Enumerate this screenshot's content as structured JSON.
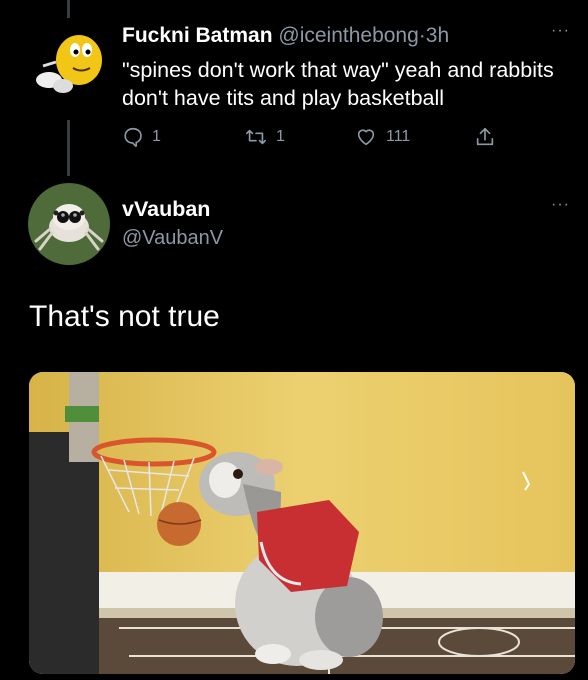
{
  "tweet1": {
    "name": "Fuckni Batman",
    "handle": "@iceinthebong",
    "separator": "·",
    "time": "3h",
    "text": "\"spines don't work that way\" yeah and rabbits don't have tits and play basketball",
    "reply_count": "1",
    "retweet_count": "1",
    "like_count": "111",
    "icons": {
      "reply": "reply-icon",
      "retweet": "retweet-icon",
      "like": "heart-icon",
      "share": "share-icon",
      "more": "more-icon"
    }
  },
  "tweet2": {
    "name": "vVauban",
    "handle": "@VaubanV",
    "text": "That's not true"
  },
  "more_label": "···",
  "colors": {
    "background": "#000000",
    "text": "#ffffff",
    "muted": "#8b98a5",
    "thread_line": "#3a3d40"
  }
}
